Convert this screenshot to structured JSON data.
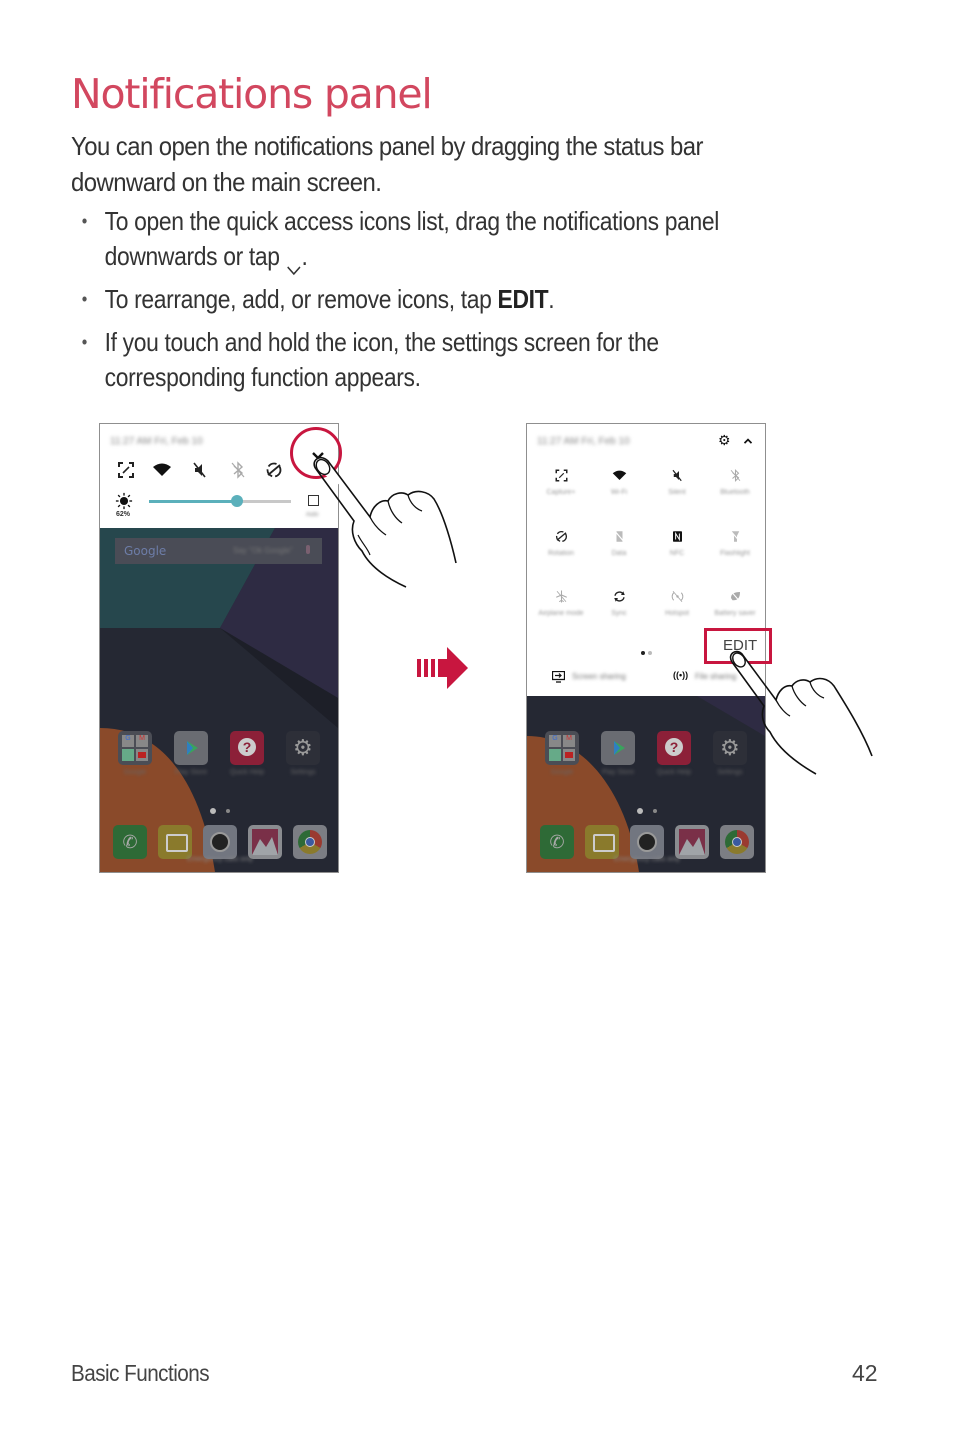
{
  "page": {
    "title": "Notifications panel",
    "intro": "You can open the notifications panel by dragging the status bar downward on the main screen.",
    "bullets": [
      {
        "text_before": "To open the quick access icons list, drag the notifications panel downwards or tap",
        "icon": "chevron-down-icon",
        "text_after": "."
      },
      {
        "text_before": "To rearrange, add, or remove icons, tap ",
        "bold": "EDIT",
        "text_after": "."
      },
      {
        "text_before": "If you touch and hold the icon, the settings screen for the corresponding function appears."
      }
    ],
    "bullet_glyph": "•"
  },
  "screen1": {
    "status_text": "11:27 AM Fri, Feb 10",
    "quick_icons": [
      "capture-icon",
      "wifi-icon",
      "silent-icon",
      "bluetooth-off-icon",
      "rotation-icon"
    ],
    "expand_icon": "chevron-down-icon",
    "brightness": {
      "percent_label": "62%",
      "value": 0.62
    },
    "auto_label": "Auto",
    "search": {
      "logo": "Google",
      "hint": "Say \"Ok Google\""
    },
    "apps": [
      "Google",
      "Play Store",
      "Quick Help",
      "Settings"
    ],
    "dock": [
      "Phone",
      "Messaging",
      "Camera",
      "Gallery",
      "Chrome"
    ],
    "emergency_text": "Emergency calls only"
  },
  "screen2": {
    "status_text": "11:27 AM Fri, Feb 10",
    "settings_icon": "gear-icon",
    "collapse_icon": "chevron-up-icon",
    "tiles": [
      {
        "icon": "capture-icon",
        "label": "Capture+"
      },
      {
        "icon": "wifi-icon",
        "label": "Wi-Fi"
      },
      {
        "icon": "silent-icon",
        "label": "Silent"
      },
      {
        "icon": "bluetooth-off-icon",
        "label": "Bluetooth"
      },
      {
        "icon": "rotation-icon",
        "label": "Rotation"
      },
      {
        "icon": "data-off-icon",
        "label": "Data"
      },
      {
        "icon": "nfc-icon",
        "label": "NFC"
      },
      {
        "icon": "flashlight-off-icon",
        "label": "Flashlight"
      },
      {
        "icon": "airplane-off-icon",
        "label": "Airplane mode"
      },
      {
        "icon": "sync-icon",
        "label": "Sync"
      },
      {
        "icon": "hotspot-off-icon",
        "label": "Hotspot"
      },
      {
        "icon": "battery-saver-off-icon",
        "label": "Battery saver"
      }
    ],
    "edit_label": "EDIT",
    "bottom_actions": [
      {
        "icon": "screen-sharing-icon",
        "label": "Screen sharing"
      },
      {
        "icon": "file-sharing-icon",
        "label": "File sharing"
      }
    ],
    "apps": [
      "Google",
      "Play Store",
      "Quick Help",
      "Settings"
    ],
    "dock": [
      "Phone",
      "Messaging",
      "Camera",
      "Gallery",
      "Chrome"
    ],
    "emergency_text": "Emergency calls only"
  },
  "footer": {
    "section": "Basic Functions",
    "page_number": "42"
  },
  "colors": {
    "title": "#d2475f",
    "highlight": "#c8163f",
    "slider": "#5bb0bb"
  }
}
